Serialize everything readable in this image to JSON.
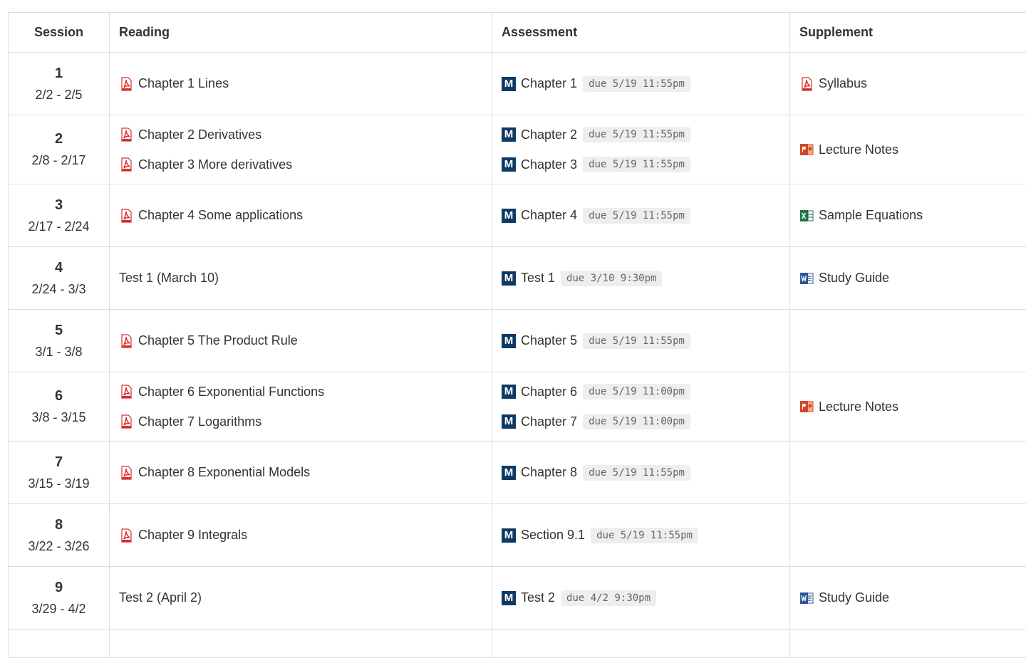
{
  "headers": {
    "session": "Session",
    "reading": "Reading",
    "assessment": "Assessment",
    "supplement": "Supplement"
  },
  "rows": [
    {
      "num": "1",
      "dates": "2/2 - 2/5",
      "readings": [
        {
          "label": "Chapter 1 Lines",
          "type": "pdf"
        }
      ],
      "assessments": [
        {
          "label": "Chapter 1",
          "due": "due 5/19 11:55pm"
        }
      ],
      "supplements": [
        {
          "label": "Syllabus",
          "type": "pdf"
        }
      ]
    },
    {
      "num": "2",
      "dates": "2/8 - 2/17",
      "readings": [
        {
          "label": "Chapter 2 Derivatives",
          "type": "pdf"
        },
        {
          "label": "Chapter 3 More derivatives",
          "type": "pdf"
        }
      ],
      "assessments": [
        {
          "label": "Chapter 2",
          "due": "due 5/19 11:55pm"
        },
        {
          "label": "Chapter 3",
          "due": "due 5/19 11:55pm"
        }
      ],
      "supplements": [
        {
          "label": "Lecture Notes",
          "type": "ppt"
        }
      ]
    },
    {
      "num": "3",
      "dates": "2/17 - 2/24",
      "readings": [
        {
          "label": "Chapter 4 Some applications",
          "type": "pdf"
        }
      ],
      "assessments": [
        {
          "label": "Chapter 4",
          "due": "due 5/19 11:55pm"
        }
      ],
      "supplements": [
        {
          "label": "Sample Equations",
          "type": "xls"
        }
      ]
    },
    {
      "num": "4",
      "dates": "2/24 - 3/3",
      "readings": [
        {
          "label": "Test 1 (March 10)",
          "type": "none"
        }
      ],
      "assessments": [
        {
          "label": "Test 1",
          "due": "due 3/10 9:30pm"
        }
      ],
      "supplements": [
        {
          "label": "Study Guide",
          "type": "doc"
        }
      ]
    },
    {
      "num": "5",
      "dates": "3/1 - 3/8",
      "readings": [
        {
          "label": "Chapter 5 The Product Rule",
          "type": "pdf"
        }
      ],
      "assessments": [
        {
          "label": "Chapter 5",
          "due": "due 5/19 11:55pm"
        }
      ],
      "supplements": []
    },
    {
      "num": "6",
      "dates": "3/8 - 3/15",
      "readings": [
        {
          "label": "Chapter 6 Exponential Functions",
          "type": "pdf"
        },
        {
          "label": "Chapter 7 Logarithms",
          "type": "pdf"
        }
      ],
      "assessments": [
        {
          "label": "Chapter 6",
          "due": "due 5/19 11:00pm"
        },
        {
          "label": "Chapter 7",
          "due": "due 5/19 11:00pm"
        }
      ],
      "supplements": [
        {
          "label": "Lecture Notes",
          "type": "ppt"
        }
      ]
    },
    {
      "num": "7",
      "dates": "3/15 - 3/19",
      "readings": [
        {
          "label": "Chapter 8 Exponential Models",
          "type": "pdf"
        }
      ],
      "assessments": [
        {
          "label": "Chapter 8",
          "due": "due 5/19 11:55pm"
        }
      ],
      "supplements": []
    },
    {
      "num": "8",
      "dates": "3/22 - 3/26",
      "readings": [
        {
          "label": "Chapter 9 Integrals",
          "type": "pdf"
        }
      ],
      "assessments": [
        {
          "label": "Section 9.1",
          "due": "due 5/19 11:55pm"
        }
      ],
      "supplements": []
    },
    {
      "num": "9",
      "dates": "3/29 - 4/2",
      "readings": [
        {
          "label": "Test 2 (April 2)",
          "type": "none"
        }
      ],
      "assessments": [
        {
          "label": "Test 2",
          "due": "due 4/2 9:30pm"
        }
      ],
      "supplements": [
        {
          "label": "Study Guide",
          "type": "doc"
        }
      ]
    }
  ],
  "assessment_icon_letter": "M",
  "icon_names": {
    "pdf": "pdf-icon",
    "ppt": "powerpoint-icon",
    "xls": "excel-icon",
    "doc": "word-icon",
    "assessment": "assessment-m-icon"
  },
  "colors": {
    "pdf": "#d9302b",
    "ppt": "#d24726",
    "xls": "#217346",
    "doc": "#2b579a",
    "assessment_box": "#0f3a66",
    "due_bg": "#eeeeee",
    "border": "#dddddd"
  }
}
